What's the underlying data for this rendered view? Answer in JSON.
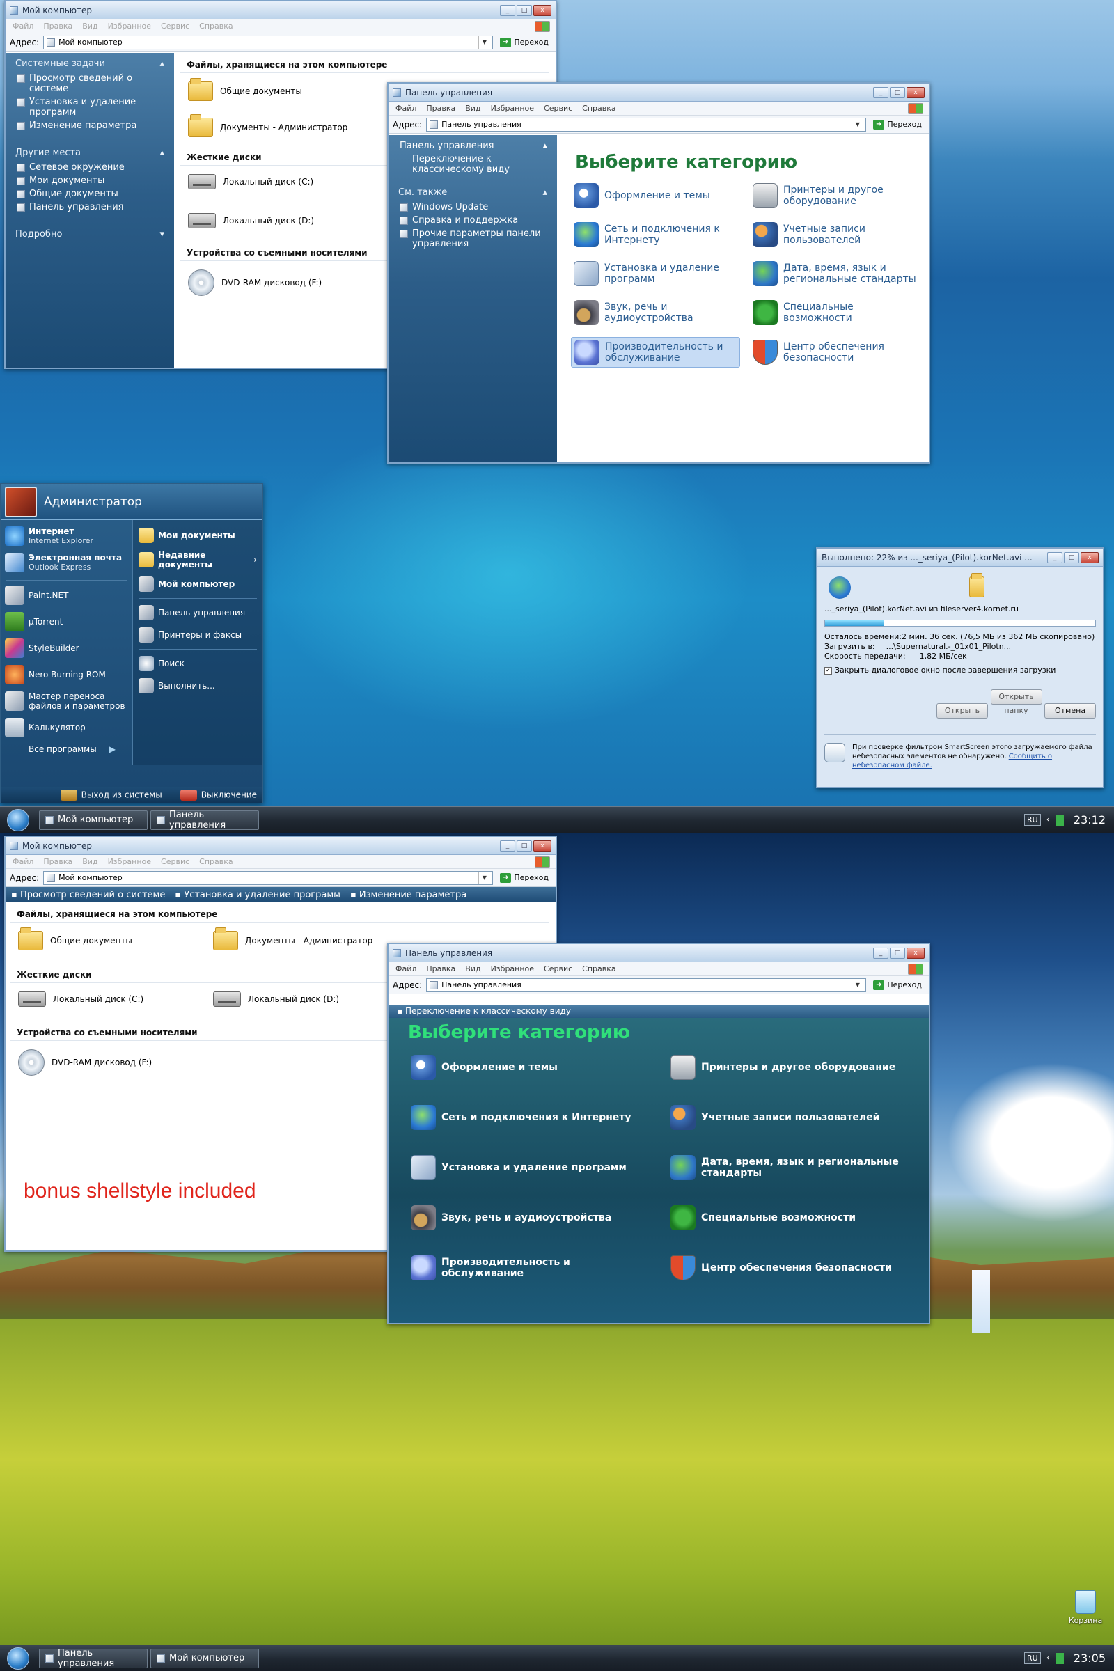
{
  "my_computer_title": "Мой компьютер",
  "control_panel_title": "Панель управления",
  "menu": [
    "Файл",
    "Правка",
    "Вид",
    "Избранное",
    "Сервис",
    "Справка"
  ],
  "address_label": "Адрес:",
  "go_label": "Переход",
  "mycomp": {
    "tasks_header": "Системные задачи",
    "tasks": [
      "Просмотр сведений о системе",
      "Установка и удаление программ",
      "Изменение параметра"
    ],
    "places_header": "Другие места",
    "places": [
      "Сетевое окружение",
      "Мои документы",
      "Общие документы",
      "Панель управления"
    ],
    "details_header": "Подробно",
    "group_files": "Файлы, хранящиеся на этом компьютере",
    "files": [
      "Общие документы",
      "Документы - Администратор"
    ],
    "group_disks": "Жесткие диски",
    "disks": [
      "Локальный диск (C:)",
      "Локальный диск (D:)"
    ],
    "group_removable": "Устройства со съемными носителями",
    "removable": [
      "DVD-RAM дисковод (F:)"
    ]
  },
  "cp": {
    "pane_header": "Панель управления",
    "switch_view": "Переключение к классическому виду",
    "see_also": "См. также",
    "links": [
      "Windows Update",
      "Справка и поддержка",
      "Прочие параметры панели управления"
    ],
    "heading": "Выберите категорию",
    "categories": [
      {
        "label": "Оформление и темы",
        "icon": "themes-icon"
      },
      {
        "label": "Принтеры и другое оборудование",
        "icon": "printer-icon"
      },
      {
        "label": "Сеть и подключения к Интернету",
        "icon": "network-icon"
      },
      {
        "label": "Учетные записи пользователей",
        "icon": "users-icon"
      },
      {
        "label": "Установка и удаление программ",
        "icon": "install-icon"
      },
      {
        "label": "Дата, время, язык и региональные стандарты",
        "icon": "datetime-icon"
      },
      {
        "label": "Звук, речь и аудиоустройства",
        "icon": "sound-icon"
      },
      {
        "label": "Специальные возможности",
        "icon": "accessibility-icon"
      },
      {
        "label": "Производительность и обслуживание",
        "icon": "performance-icon"
      },
      {
        "label": "Центр обеспечения безопасности",
        "icon": "shield-icon"
      }
    ]
  },
  "start_menu": {
    "user": "Администратор",
    "pinned": [
      {
        "title": "Интернет",
        "sub": "Internet Explorer"
      },
      {
        "title": "Электронная почта",
        "sub": "Outlook Express"
      }
    ],
    "recent": [
      "Paint.NET",
      "µTorrent",
      "StyleBuilder",
      "Nero Burning ROM",
      "Мастер переноса файлов и параметров",
      "Калькулятор"
    ],
    "all_programs": "Все программы",
    "right": [
      "Мои документы",
      "Недавние документы",
      "Мой компьютер",
      "Панель управления",
      "Принтеры и факсы",
      "Поиск",
      "Выполнить..."
    ],
    "logoff": "Выход из системы",
    "shutdown": "Выключение"
  },
  "download": {
    "title": "Выполнено: 22% из ..._seriya_(Pilot).korNet.avi ...",
    "progress": 0.22,
    "file_line": "..._seriya_(Pilot).korNet.avi из fileserver4.kornet.ru",
    "remaining": "Осталось времени:2 мин. 36 сек. (76,5 МБ из 362 МБ скопировано)",
    "dest_label": "Загрузить в:",
    "dest": "...\\Supernatural.-_01x01_Pilotn...",
    "speed_label": "Скорость передачи:",
    "speed": "1,82 МБ/сек",
    "checkbox": "Закрыть диалоговое окно после завершения загрузки",
    "btn_open": "Открыть",
    "btn_folder": "Открыть папку",
    "btn_cancel": "Отмена",
    "smartscreen": "При проверке фильтром SmartScreen этого загружаемого файла небезопасных элементов не обнаружено.",
    "report_link": "Сообщить о небезопасном файле."
  },
  "taskbar1": {
    "buttons": [
      "Мой компьютер",
      "Панель управления"
    ],
    "lang": "RU",
    "clock": "23:12"
  },
  "taskbar2": {
    "buttons": [
      "Панель управления",
      "Мой компьютер"
    ],
    "lang": "RU",
    "clock": "23:05"
  },
  "mycomp2_toolbar": [
    "Просмотр сведений о системе",
    "Установка и удаление программ",
    "Изменение параметра"
  ],
  "cp2_switch": "Переключение к классическому виду",
  "bonus_text": "bonus shellstyle included",
  "recycle_bin": "Корзина",
  "colors": {
    "accent": "#2b5d91",
    "heading_green": "#1f8a3b",
    "bonus_red": "#e0241b"
  }
}
